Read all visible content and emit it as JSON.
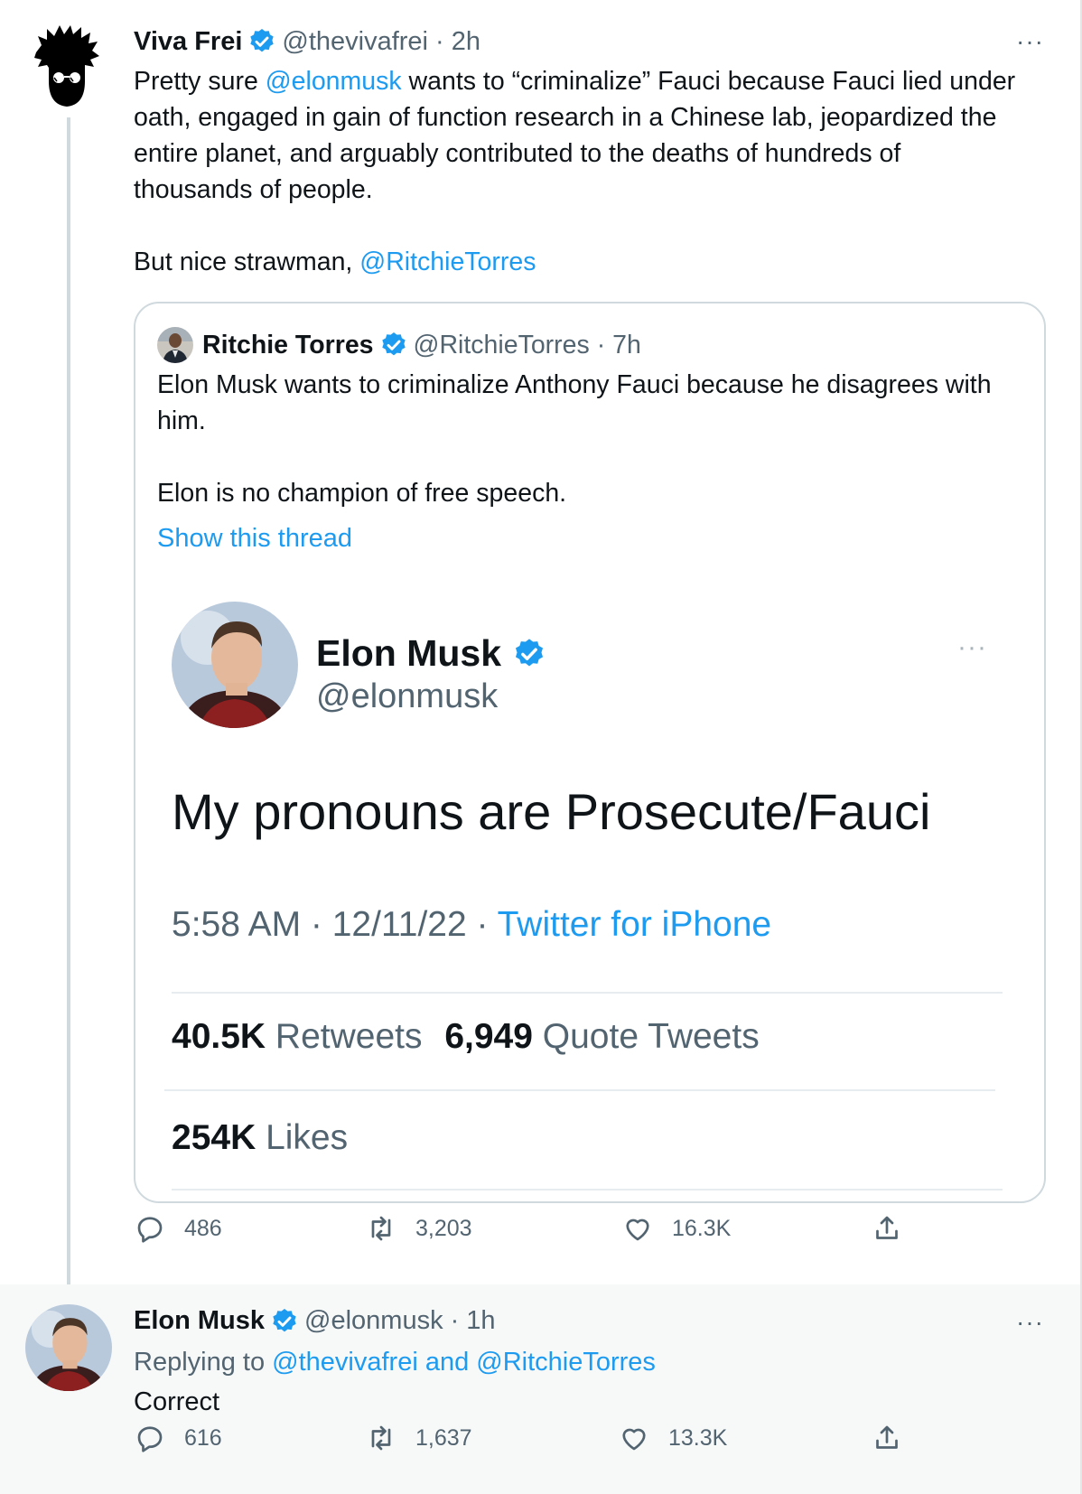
{
  "tweet1": {
    "author_name": "Viva Frei",
    "handle": "@thevivafrei",
    "time": "· 2h",
    "more": "···",
    "text_pre": "Pretty sure ",
    "mention1": "@elonmusk",
    "text_post": " wants to “criminalize” Fauci because Fauci lied under oath, engaged in gain of function research in a Chinese lab, jeopardized the entire planet, and arguably contributed to the deaths of hundreds of thousands of people.",
    "para2_pre": "But nice strawman, ",
    "mention2": "@RitchieTorres",
    "replies": "486",
    "retweets": "3,203",
    "likes": "16.3K"
  },
  "quote": {
    "author_name": "Ritchie Torres",
    "handle": "@RitchieTorres",
    "time": "· 7h",
    "line1": "Elon Musk wants to criminalize Anthony Fauci because he disagrees with him.",
    "line2": "Elon is no champion of free speech.",
    "show_thread": "Show this thread",
    "screenshot": {
      "name": "Elon Musk",
      "handle": "@elonmusk",
      "more": "···",
      "text": "My pronouns are Prosecute/Fauci",
      "time": "5:58 AM · 12/11/22 · ",
      "source": "Twitter for iPhone",
      "retweets_count": "40.5K",
      "retweets_label": " Retweets",
      "quotes_count": "6,949",
      "quotes_label": " Quote Tweets",
      "likes_count": "254K",
      "likes_label": " Likes"
    }
  },
  "tweet2": {
    "author_name": "Elon Musk",
    "handle": "@elonmusk",
    "time": "· 1h",
    "more": "···",
    "replying_label": "Replying to ",
    "replying_to": "@thevivafrei and @RitchieTorres",
    "text": "Correct",
    "replies": "616",
    "retweets": "1,637",
    "likes": "13.3K"
  },
  "colors": {
    "link": "#1d9bf0",
    "secondary": "#536471",
    "verified": "#1d9bf0",
    "reply_bg": "#f7f9f9"
  }
}
